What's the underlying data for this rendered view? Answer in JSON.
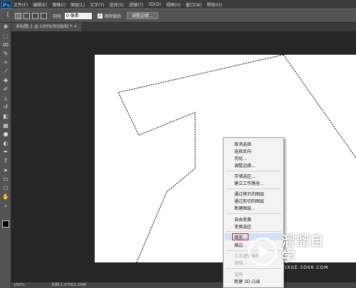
{
  "app": {
    "logo_text": "Ps"
  },
  "menubar": {
    "items": [
      "文件(F)",
      "编辑(E)",
      "图像(I)",
      "图层(L)",
      "文字(Y)",
      "选择(S)",
      "滤镜(T)",
      "3D(D)",
      "视图(V)",
      "窗口(W)",
      "帮助(H)"
    ]
  },
  "options": {
    "tool_icon": "lasso-icon",
    "feather_label": "羽化:",
    "feather_value": "0 像素",
    "antialias_checked": "✓",
    "antialias_label": "消除锯齿",
    "refine_edge_label": "调整边缘..."
  },
  "tabs": [
    {
      "label": "未标题-1 @ 100%(RGB/8) * ×"
    }
  ],
  "status": {
    "zoom": "100%",
    "doc_info": "文档:1.57M/1.20M"
  },
  "context_menu": {
    "items": [
      {
        "label": "取消选择",
        "enabled": true
      },
      {
        "label": "选择反向",
        "enabled": true
      },
      {
        "label": "羽化...",
        "enabled": true
      },
      {
        "label": "调整边缘...",
        "enabled": true
      },
      {
        "label": "存储选区...",
        "enabled": true
      },
      {
        "label": "建立工作路径...",
        "enabled": true
      },
      {
        "label": "通过拷贝的图层",
        "enabled": true
      },
      {
        "label": "通过剪切的图层",
        "enabled": true
      },
      {
        "label": "新建图层...",
        "enabled": true
      },
      {
        "label": "自由变换",
        "enabled": true
      },
      {
        "label": "变换选区",
        "enabled": true
      },
      {
        "label": "填充...",
        "enabled": true,
        "highlighted": true
      },
      {
        "label": "描边...",
        "enabled": true
      },
      {
        "label": "上次滤镜操作",
        "enabled": false
      },
      {
        "label": "渐隐...",
        "enabled": false
      },
      {
        "label": "渲染",
        "enabled": false
      },
      {
        "label": "新建 3D 凸出",
        "enabled": true
      }
    ]
  },
  "watermark": {
    "title": "溜溜自学",
    "subtitle": "ZIXUE.3D66.COM"
  }
}
